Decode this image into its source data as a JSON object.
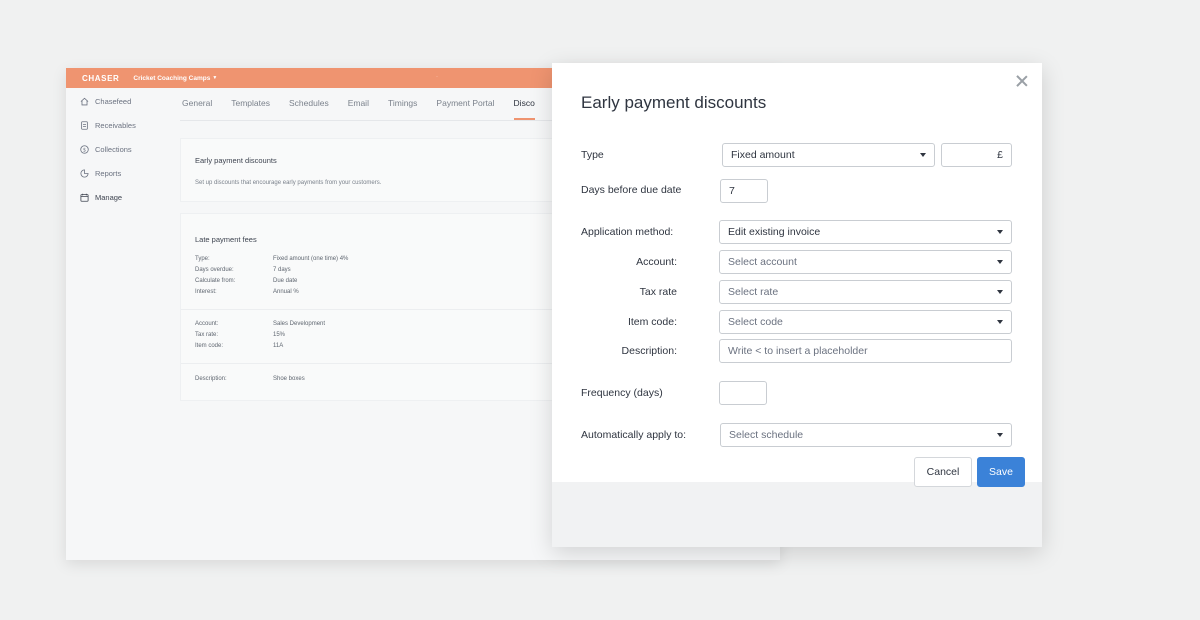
{
  "app": {
    "logo": "CHASER",
    "org_name": "Cricket Coaching Camps",
    "sidebar": [
      {
        "label": "Chasefeed",
        "icon": "home-icon"
      },
      {
        "label": "Receivables",
        "icon": "document-icon"
      },
      {
        "label": "Collections",
        "icon": "dollar-icon"
      },
      {
        "label": "Reports",
        "icon": "chart-icon"
      },
      {
        "label": "Manage",
        "icon": "calendar-icon"
      }
    ],
    "tabs": [
      "General",
      "Templates",
      "Schedules",
      "Email",
      "Timings",
      "Payment Portal",
      "Disco"
    ],
    "early_card": {
      "title": "Early payment discounts",
      "subtitle": "Set up discounts that encourage early payments from your customers."
    },
    "late_card": {
      "title": "Late payment fees",
      "rows1": [
        {
          "k": "Type:",
          "v": "Fixed amount (one time) 4%"
        },
        {
          "k": "Days overdue:",
          "v": "7 days"
        },
        {
          "k": "Calculate from:",
          "v": "Due date"
        },
        {
          "k": "Interest:",
          "v": "Annual %"
        }
      ],
      "rows2": [
        {
          "k": "Account:",
          "v": "Sales Development"
        },
        {
          "k": "Tax rate:",
          "v": "15%"
        },
        {
          "k": "Item code:",
          "v": "11A"
        }
      ],
      "rows3": [
        {
          "k": "Description:",
          "v": "Shoe boxes"
        }
      ]
    }
  },
  "modal": {
    "title": "Early payment discounts",
    "type_label": "Type",
    "type_value": "Fixed amount",
    "currency_symbol": "£",
    "days_label": "Days before due date",
    "days_value": "7",
    "method_label": "Application method:",
    "method_value": "Edit existing invoice",
    "account_label": "Account:",
    "account_placeholder": "Select account",
    "tax_label": "Tax rate",
    "tax_placeholder": "Select rate",
    "item_label": "Item code:",
    "item_placeholder": "Select code",
    "desc_label": "Description:",
    "desc_placeholder": "Write < to insert a placeholder",
    "freq_label": "Frequency (days)",
    "apply_label": "Automatically apply to:",
    "apply_placeholder": "Select schedule",
    "cancel_label": "Cancel",
    "save_label": "Save"
  }
}
